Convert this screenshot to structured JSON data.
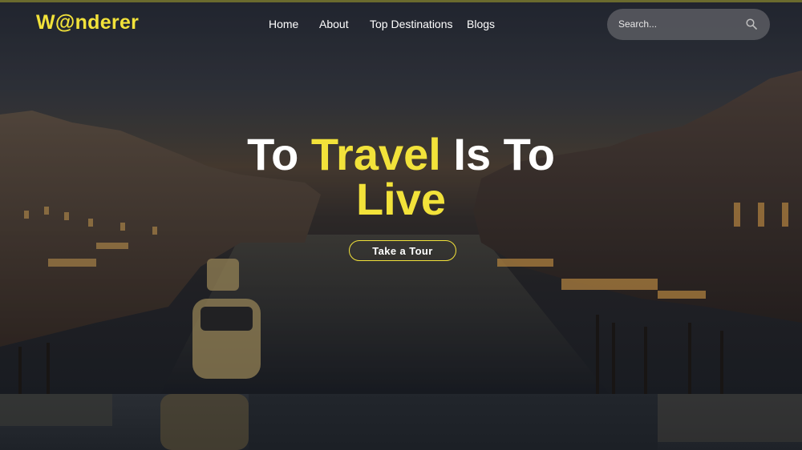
{
  "logo": "W@nderer",
  "nav": [
    "Home",
    "About",
    "Top Destinations",
    "Blogs"
  ],
  "search": {
    "placeholder": "Search..."
  },
  "hero": {
    "line1_a": "To ",
    "line1_b": "Travel",
    "line1_c": " Is To",
    "line2": "Live",
    "cta": "Take a Tour"
  },
  "colors": {
    "accent": "#f2e23a",
    "text": "#ffffff"
  },
  "icons": [
    "search-icon"
  ]
}
